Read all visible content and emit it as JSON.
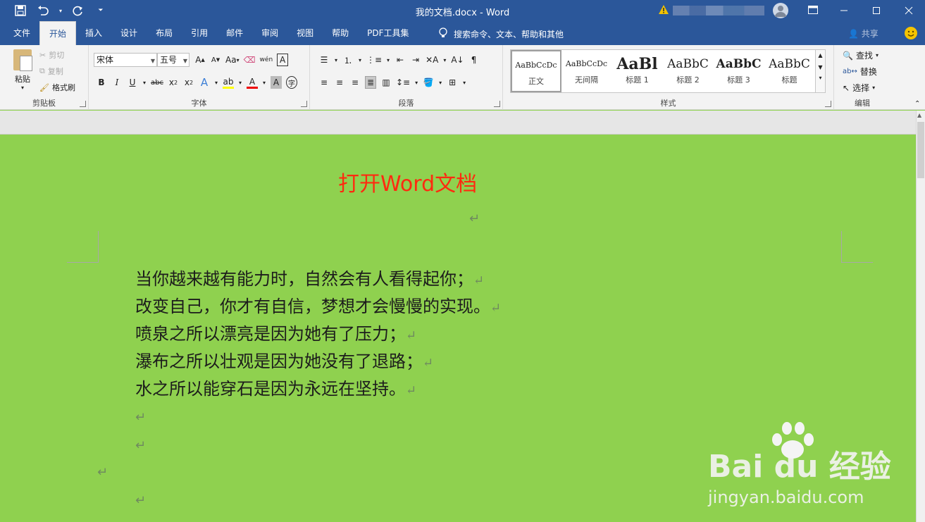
{
  "window": {
    "title": "我的文档.docx  -  Word"
  },
  "tabs": [
    "文件",
    "开始",
    "插入",
    "设计",
    "布局",
    "引用",
    "邮件",
    "审阅",
    "视图",
    "帮助",
    "PDF工具集"
  ],
  "active_tab": "开始",
  "tell_me": "搜索命令、文本、帮助和其他",
  "share": "共享",
  "clipboard": {
    "paste": "粘贴",
    "cut": "剪切",
    "copy": "复制",
    "format_painter": "格式刷",
    "label": "剪贴板"
  },
  "font": {
    "name": "宋体",
    "size": "五号",
    "case_btn": "Aa",
    "label": "字体"
  },
  "paragraph": {
    "label": "段落"
  },
  "styles": {
    "items": [
      {
        "sample": "AaBbCcDc",
        "name": "正文"
      },
      {
        "sample": "AaBbCcDc",
        "name": "无间隔"
      },
      {
        "sample": "AaBl",
        "name": "标题 1"
      },
      {
        "sample": "AaBbC",
        "name": "标题 2"
      },
      {
        "sample": "AaBbC",
        "name": "标题 3"
      },
      {
        "sample": "AaBbC",
        "name": "标题"
      }
    ],
    "label": "样式"
  },
  "editing": {
    "find": "查找",
    "replace": "替换",
    "select": "选择",
    "label": "编辑"
  },
  "document": {
    "title": "打开Word文档",
    "lines": [
      "当你越来越有能力时，自然会有人看得起你；",
      "改变自己，你才有自信，梦想才会慢慢的实现。",
      "喷泉之所以漂亮是因为她有了压力；",
      "瀑布之所以壮观是因为她没有了退路；",
      "水之所以能穿石是因为永远在坚持。"
    ],
    "paragraph_mark": "↵",
    "background_color": "#8fd14f",
    "title_color": "#ff2a10"
  },
  "watermark": {
    "logo": "Bai du 经验",
    "url": "jingyan.baidu.com"
  },
  "colors": {
    "accent": "#2b579a",
    "ribbon_bg": "#f3f3f3"
  }
}
